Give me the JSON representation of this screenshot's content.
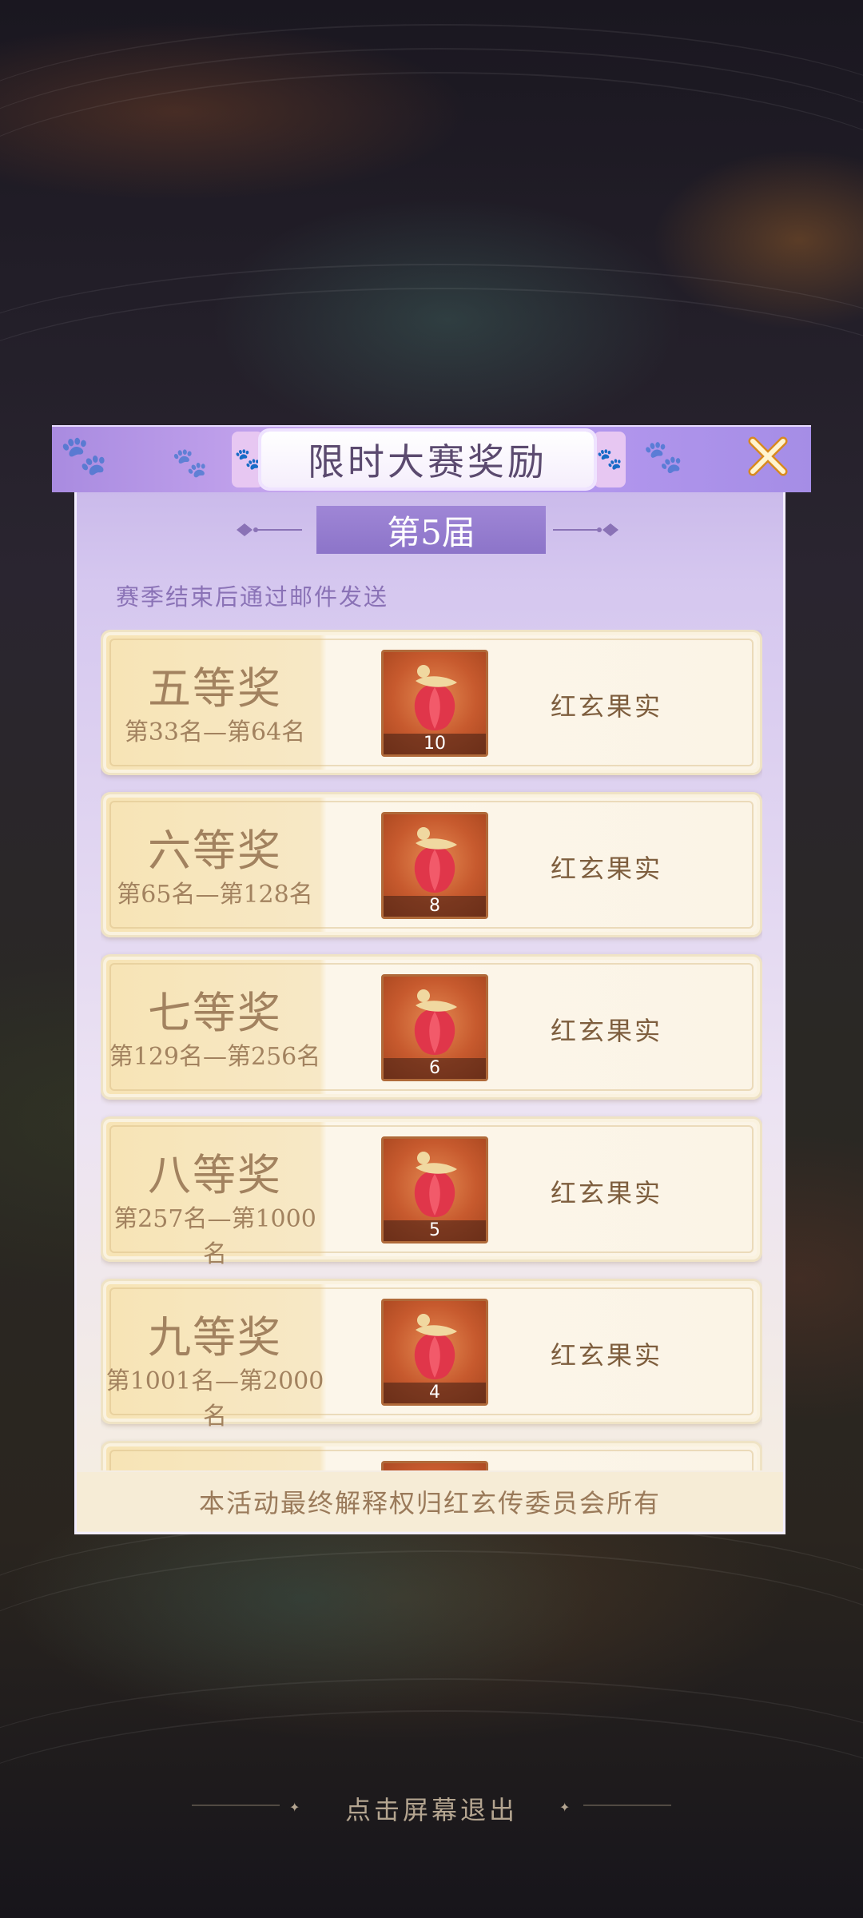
{
  "popup": {
    "title": "限时大赛奖励",
    "session": "第5届",
    "subtitle": "赛季结束后通过邮件发送",
    "footer": "本活动最终解释权归红玄传委员会所有",
    "close_icon": "close-x-icon"
  },
  "rewards": [
    {
      "rank": "五等奖",
      "range": "第33名—第64名",
      "item_name": "红玄果实",
      "qty": "10",
      "icon": "red-fruit-icon"
    },
    {
      "rank": "六等奖",
      "range": "第65名—第128名",
      "item_name": "红玄果实",
      "qty": "8",
      "icon": "red-fruit-icon"
    },
    {
      "rank": "七等奖",
      "range": "第129名—第256名",
      "item_name": "红玄果实",
      "qty": "6",
      "icon": "red-fruit-icon"
    },
    {
      "rank": "八等奖",
      "range": "第257名—第1000名",
      "item_name": "红玄果实",
      "qty": "5",
      "icon": "red-fruit-icon"
    },
    {
      "rank": "九等奖",
      "range": "第1001名—第2000名",
      "item_name": "红玄果实",
      "qty": "4",
      "icon": "red-fruit-icon"
    }
  ],
  "exit_hint": "点击屏幕退出",
  "colors": {
    "panel_purple": "#b79af0",
    "card_cream": "#fbf4e6",
    "text_brown": "#a2825f"
  }
}
